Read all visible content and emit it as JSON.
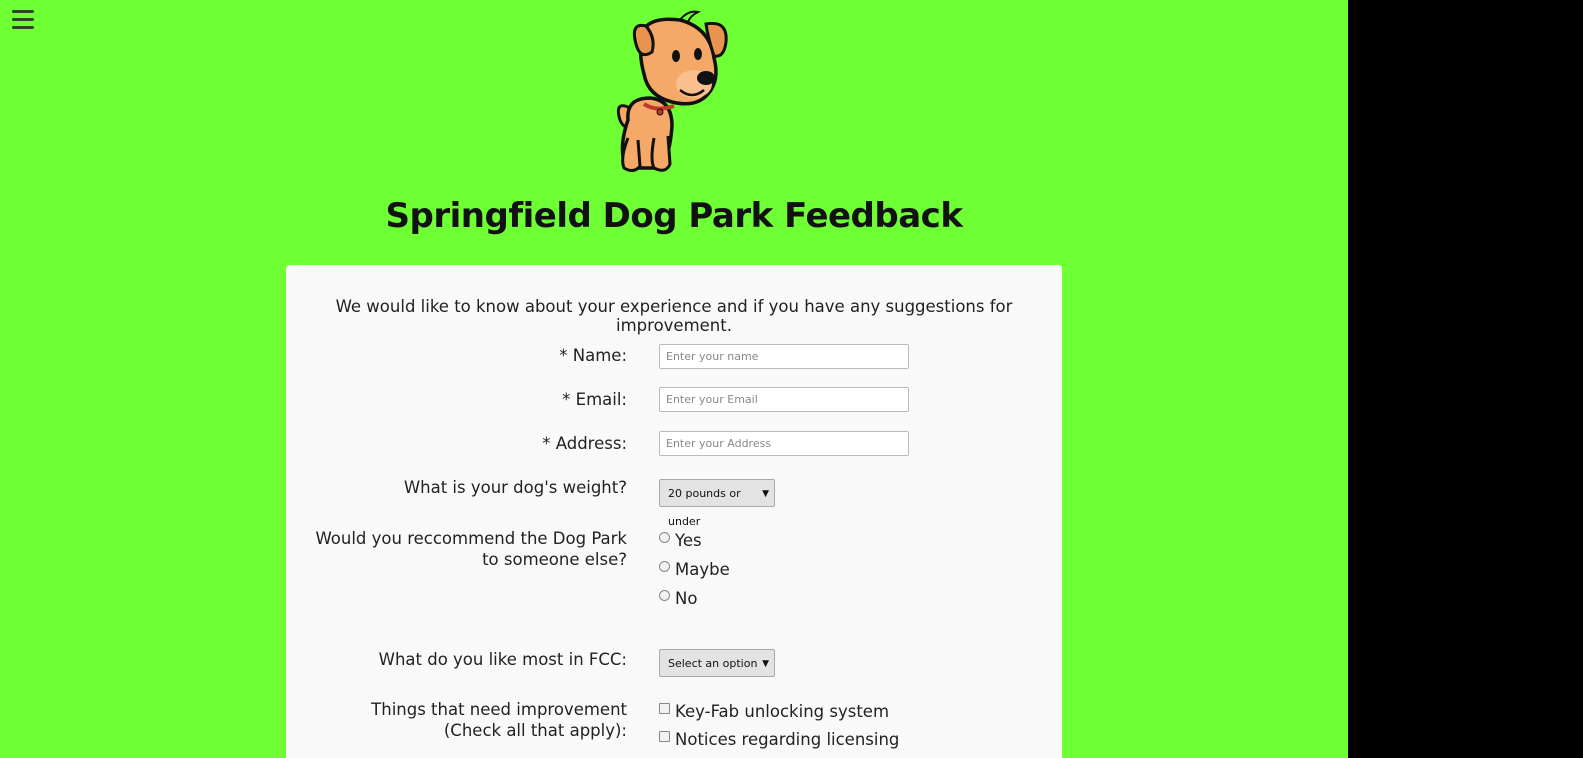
{
  "header": {
    "title": "Springfield Dog Park Feedback",
    "menu_icon": "hamburger-menu-icon",
    "logo_icon": "cartoon-dog-logo"
  },
  "form": {
    "intro": "We would like to know about your experience and if you have any suggestions for improvement.",
    "name": {
      "label": "* Name:",
      "placeholder": "Enter your name",
      "value": ""
    },
    "email": {
      "label": "* Email:",
      "placeholder": "Enter your Email",
      "value": ""
    },
    "address": {
      "label": "* Address:",
      "placeholder": "Enter your Address",
      "value": ""
    },
    "weight": {
      "label": "What is your dog's weight?",
      "selected": "20 pounds or under"
    },
    "recommend": {
      "label_line1": "Would you reccommend the Dog Park",
      "label_line2": "to someone else?",
      "options": [
        "Yes",
        "Maybe",
        "No"
      ]
    },
    "like_most": {
      "label": "What do you like most in FCC:",
      "selected": "Select an option"
    },
    "improvement": {
      "label_line1": "Things that need improvement",
      "label_line2": "(Check all that apply):",
      "options": [
        "Key-Fab unlocking system",
        "Notices regarding licensing"
      ]
    }
  },
  "colors": {
    "page_background": "#6FFF35",
    "card_background": "#F9F9F9",
    "outside_background": "#000000"
  }
}
